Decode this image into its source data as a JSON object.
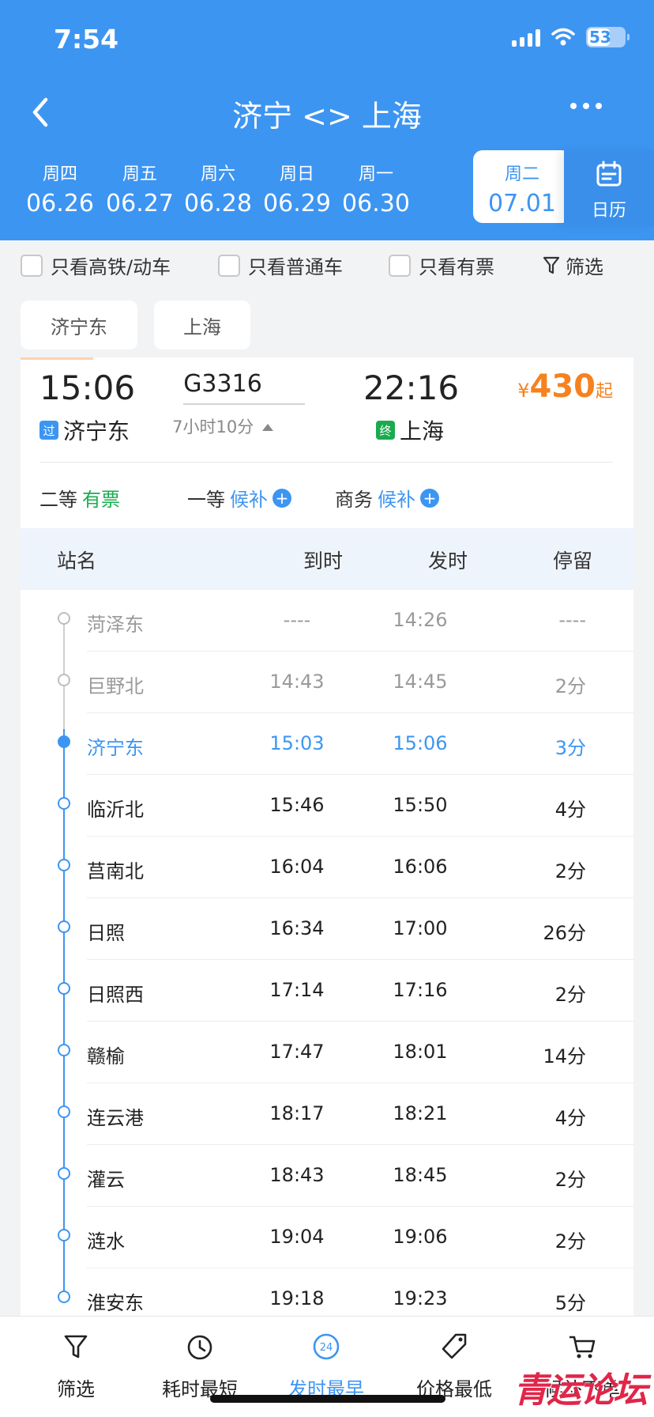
{
  "status": {
    "time": "7:54",
    "battery": "53"
  },
  "header": {
    "title": "济宁 <> 上海"
  },
  "dates": [
    {
      "weekday": "周四",
      "date": "06.26",
      "selected": false
    },
    {
      "weekday": "周五",
      "date": "06.27",
      "selected": false
    },
    {
      "weekday": "周六",
      "date": "06.28",
      "selected": false
    },
    {
      "weekday": "周日",
      "date": "06.29",
      "selected": false
    },
    {
      "weekday": "周一",
      "date": "06.30",
      "selected": false
    },
    {
      "weekday": "周二",
      "date": "07.01",
      "selected": true
    }
  ],
  "calendar_label": "日历",
  "filters": {
    "high_speed": "只看高铁/动车",
    "normal": "只看普通车",
    "available": "只看有票",
    "filter": "筛选"
  },
  "station_chips": {
    "from": "济宁东",
    "to": "上海"
  },
  "train": {
    "departure_time": "15:06",
    "train_no": "G3316",
    "duration": "7小时10分",
    "arrival_time": "22:16",
    "from_tag": "过",
    "from_station": "济宁东",
    "to_tag": "终",
    "to_station": "上海",
    "price_currency": "¥",
    "price": "430",
    "price_suffix": "起",
    "seats": [
      {
        "class": "二等",
        "status": "有票"
      },
      {
        "class": "一等",
        "status": "候补"
      },
      {
        "class": "商务",
        "status": "候补"
      }
    ]
  },
  "timetable": {
    "headers": {
      "station": "站名",
      "arrive": "到时",
      "depart": "发时",
      "stop": "停留"
    },
    "rows": [
      {
        "station": "菏泽东",
        "arrive": "----",
        "depart": "14:26",
        "stop": "----",
        "state": "past"
      },
      {
        "station": "巨野北",
        "arrive": "14:43",
        "depart": "14:45",
        "stop": "2分",
        "state": "past"
      },
      {
        "station": "济宁东",
        "arrive": "15:03",
        "depart": "15:06",
        "stop": "3分",
        "state": "current"
      },
      {
        "station": "临沂北",
        "arrive": "15:46",
        "depart": "15:50",
        "stop": "4分",
        "state": "future"
      },
      {
        "station": "莒南北",
        "arrive": "16:04",
        "depart": "16:06",
        "stop": "2分",
        "state": "future"
      },
      {
        "station": "日照",
        "arrive": "16:34",
        "depart": "17:00",
        "stop": "26分",
        "state": "future"
      },
      {
        "station": "日照西",
        "arrive": "17:14",
        "depart": "17:16",
        "stop": "2分",
        "state": "future"
      },
      {
        "station": "赣榆",
        "arrive": "17:47",
        "depart": "18:01",
        "stop": "14分",
        "state": "future"
      },
      {
        "station": "连云港",
        "arrive": "18:17",
        "depart": "18:21",
        "stop": "4分",
        "state": "future"
      },
      {
        "station": "灌云",
        "arrive": "18:43",
        "depart": "18:45",
        "stop": "2分",
        "state": "future"
      },
      {
        "station": "涟水",
        "arrive": "19:04",
        "depart": "19:06",
        "stop": "2分",
        "state": "future"
      },
      {
        "station": "淮安东",
        "arrive": "19:18",
        "depart": "19:23",
        "stop": "5分",
        "state": "future"
      }
    ]
  },
  "bottom_tabs": [
    {
      "label": "筛选",
      "icon": "filter-icon"
    },
    {
      "label": "耗时最短",
      "icon": "clock-icon"
    },
    {
      "label": "发时最早",
      "icon": "24h-icon",
      "icon_text": "24",
      "active": true
    },
    {
      "label": "价格最低",
      "icon": "price-tag-icon"
    },
    {
      "label": "候补下单",
      "icon": "cart-icon"
    }
  ],
  "watermark": "青运论坛",
  "colors": {
    "primary": "#3d95f2",
    "price": "#f5821f",
    "available": "#1aab4e"
  }
}
